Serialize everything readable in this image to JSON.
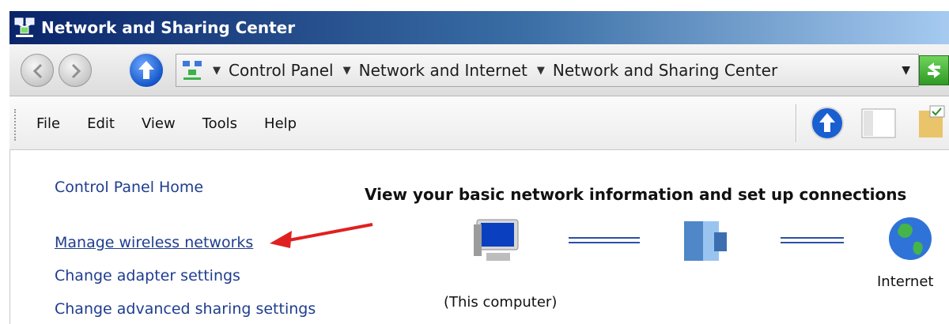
{
  "window": {
    "title": "Network and Sharing Center"
  },
  "address_bar": {
    "crumbs": [
      "Control Panel",
      "Network and Internet",
      "Network and Sharing Center"
    ]
  },
  "menu": [
    "File",
    "Edit",
    "View",
    "Tools",
    "Help"
  ],
  "left_pane": {
    "home": "Control Panel Home",
    "links": [
      "Manage wireless networks",
      "Change adapter settings",
      "Change advanced sharing settings"
    ]
  },
  "main": {
    "heading": "View your basic network information and set up connections",
    "computer_label": "(This computer)",
    "internet_label": "Internet"
  },
  "icons": {
    "back": "back-arrow-icon",
    "forward": "forward-arrow-icon",
    "up": "up-arrow-icon",
    "network": "network-icon",
    "computer": "computer-icon",
    "server": "network-building-icon",
    "globe": "globe-icon",
    "annotation": "red-arrow-icon"
  },
  "colors": {
    "title_gradient_start": "#0a246a",
    "link": "#1f3d8f",
    "annotation": "#e02020"
  }
}
